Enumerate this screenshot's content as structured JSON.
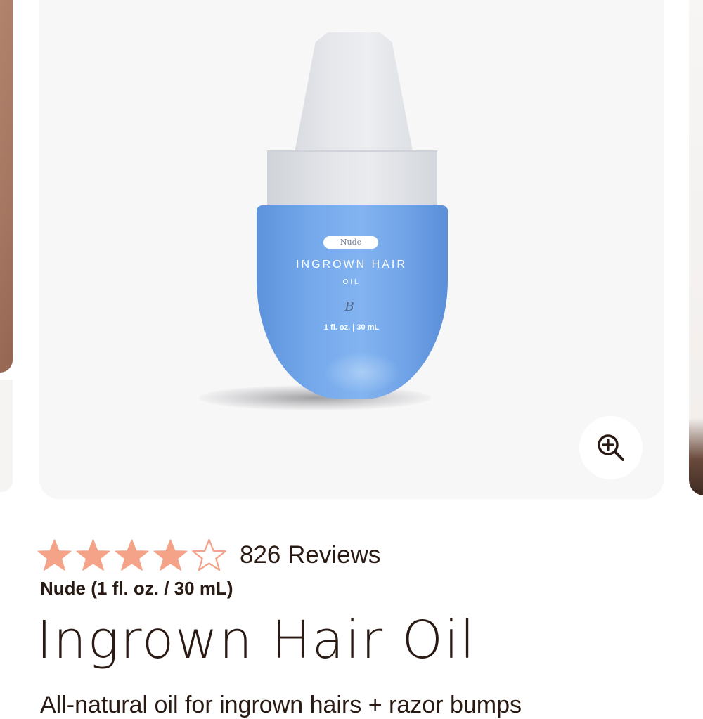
{
  "gallery": {
    "bottle": {
      "pill_label": "Nude",
      "title": "INGROWN HAIR",
      "subtitle": "OIL",
      "logo_mark": "B",
      "size": "1 fl. oz. | 30 mL"
    },
    "zoom_icon": "zoom-in-icon"
  },
  "product": {
    "rating": 4,
    "rating_max": 5,
    "reviews_label": "826 Reviews",
    "variant": "Nude (1 fl. oz. / 30 mL)",
    "title": "Ingrown Hair Oil",
    "description": "All-natural oil for ingrown hairs + razor bumps"
  },
  "colors": {
    "star_filled": "#f4a388",
    "star_outline": "#f4a388",
    "text": "#2a1a14",
    "bottle_blue": "#76a9ec"
  }
}
